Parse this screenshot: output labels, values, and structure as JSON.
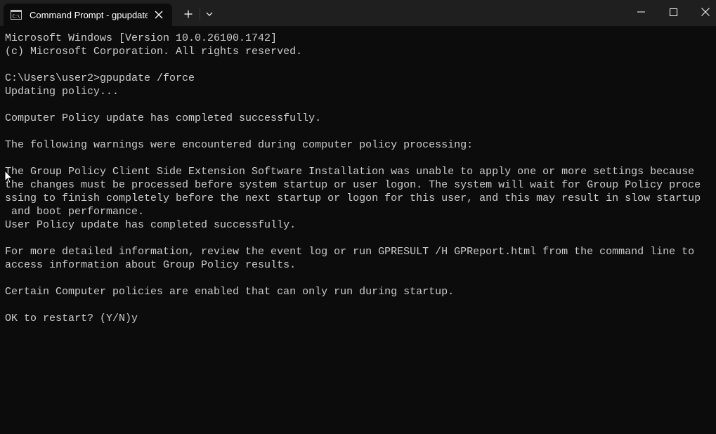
{
  "window": {
    "tab_title": "Command Prompt - gpupdate",
    "icons": {
      "tab_icon": "cmd-icon",
      "close_tab": "close-icon",
      "new_tab": "plus-icon",
      "dropdown": "chevron-down-icon",
      "minimize": "minimize-icon",
      "maximize": "maximize-icon",
      "close_window": "close-icon"
    }
  },
  "terminal": {
    "lines": [
      "Microsoft Windows [Version 10.0.26100.1742]",
      "(c) Microsoft Corporation. All rights reserved.",
      "",
      "C:\\Users\\user2>gpupdate /force",
      "Updating policy...",
      "",
      "Computer Policy update has completed successfully.",
      "",
      "The following warnings were encountered during computer policy processing:",
      "",
      "The Group Policy Client Side Extension Software Installation was unable to apply one or more settings because",
      "the changes must be processed before system startup or user logon. The system will wait for Group Policy proce",
      "ssing to finish completely before the next startup or logon for this user, and this may result in slow startup",
      " and boot performance.",
      "User Policy update has completed successfully.",
      "",
      "For more detailed information, review the event log or run GPRESULT /H GPReport.html from the command line to",
      "access information about Group Policy results.",
      "",
      "Certain Computer policies are enabled that can only run during startup.",
      "",
      "OK to restart? (Y/N)y"
    ]
  },
  "colors": {
    "background": "#0c0c0c",
    "titlebar": "#1f1f1f",
    "text": "#cccccc"
  }
}
